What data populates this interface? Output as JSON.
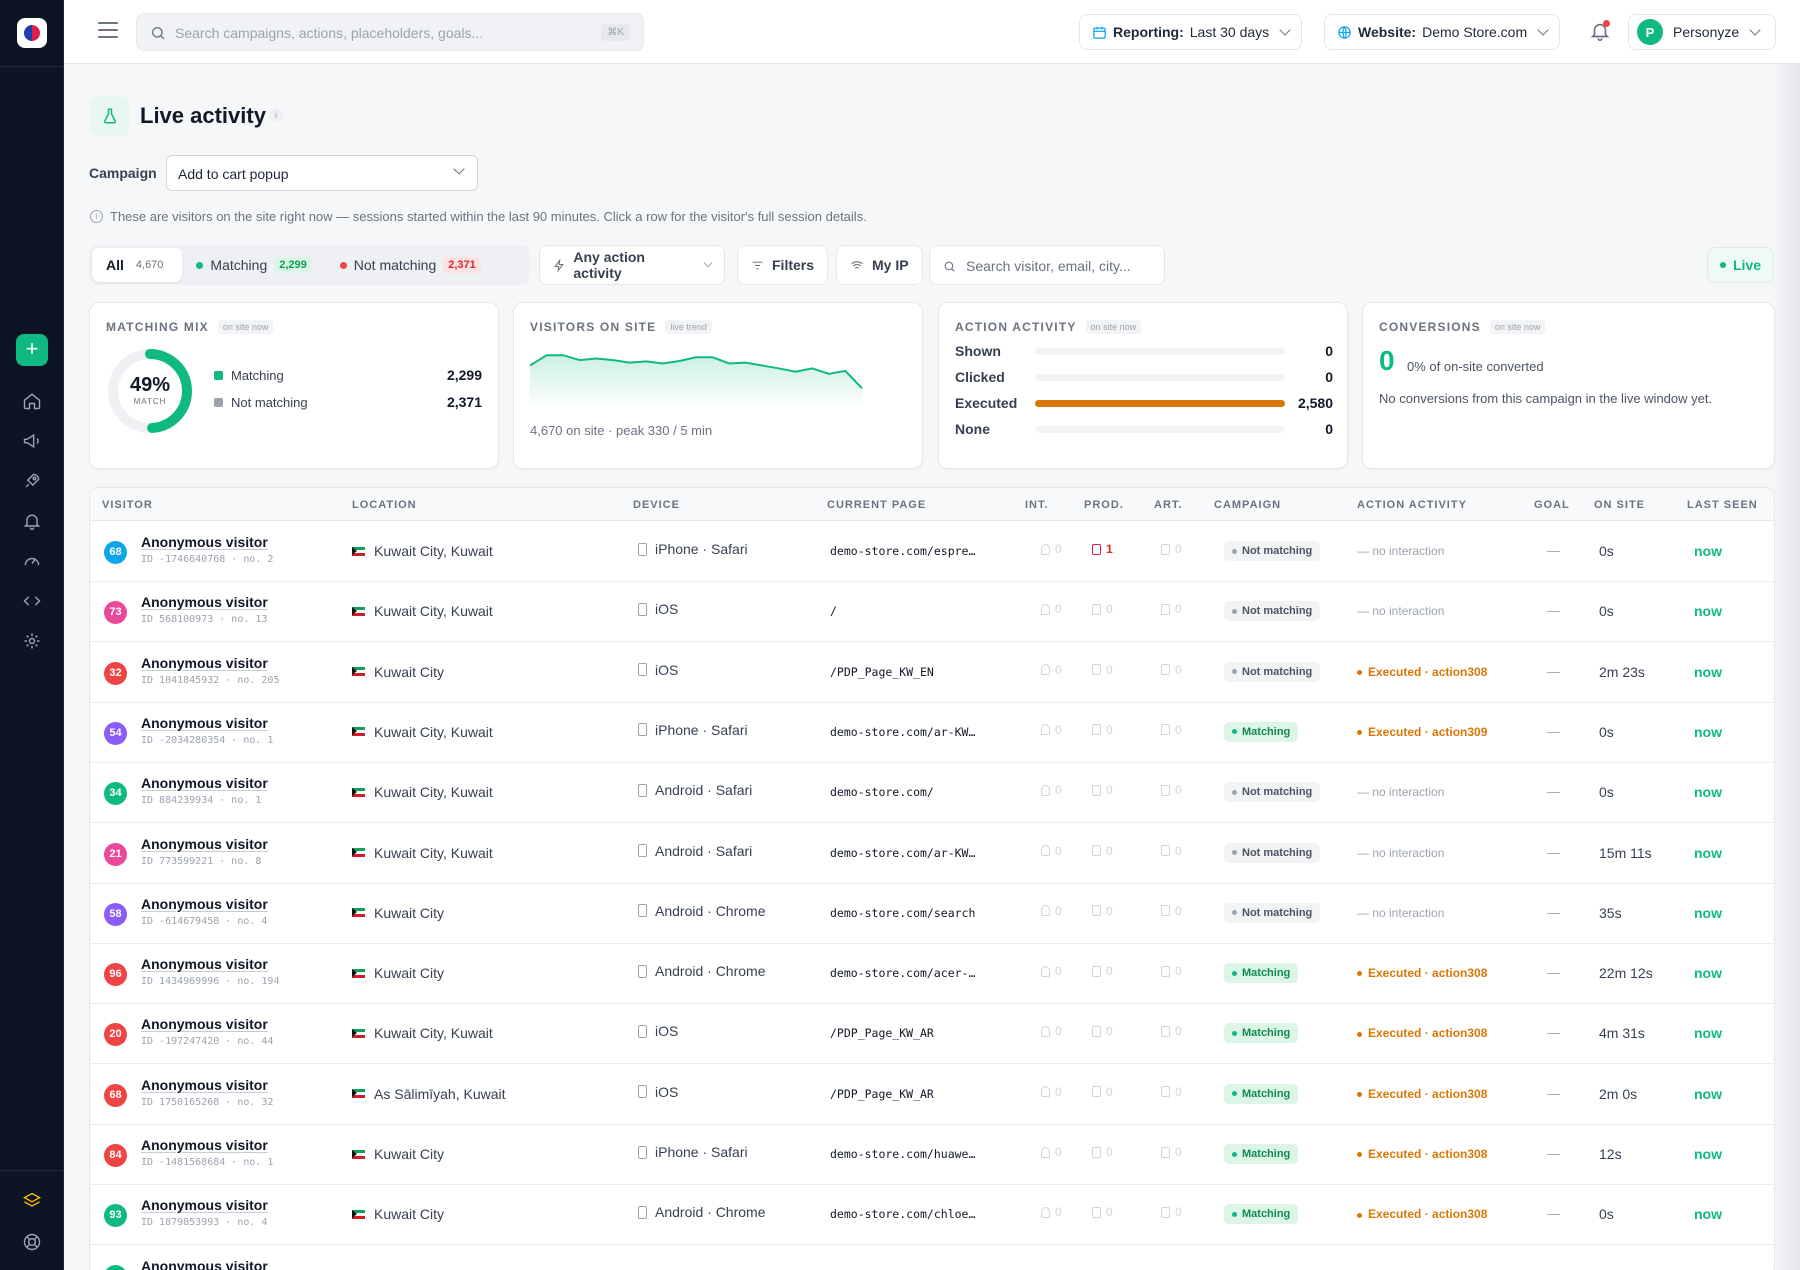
{
  "topbar": {
    "search_placeholder": "Search campaigns, actions, placeholders, goals...",
    "shortcut": "⌘K",
    "reporting_label": "Reporting:",
    "reporting_value": "Last 30 days",
    "website_label": "Website:",
    "website_value": "Demo Store.com",
    "user_initial": "P",
    "user_name": "Personyze"
  },
  "page": {
    "title": "Live activity",
    "info": "i",
    "campaign_label": "Campaign",
    "campaign_value": "Add to cart popup",
    "note": "These are visitors on the site right now — sessions started within the last 90 minutes. Click a row for the visitor's full session details."
  },
  "filters": {
    "all_label": "All",
    "all_count": "4,670",
    "matching_label": "Matching",
    "matching_count": "2,299",
    "not_matching_label": "Not matching",
    "not_matching_count": "2,371",
    "action_activity": "Any action activity",
    "filters": "Filters",
    "my_ip": "My IP",
    "search_placeholder": "Search visitor, email, city...",
    "live": "Live"
  },
  "cards": {
    "mix": {
      "title": "MATCHING MIX",
      "tag": "on site now",
      "pct": "49%",
      "pct_label": "MATCH",
      "match_fraction": 0.49,
      "rows": [
        {
          "label": "Matching",
          "value": "2,299",
          "color": "#10b981"
        },
        {
          "label": "Not matching",
          "value": "2,371",
          "color": "#9ca3af"
        }
      ]
    },
    "visitors": {
      "title": "VISITORS ON SITE",
      "tag": "live trend",
      "caption": "4,670 on site · peak 330 / 5 min"
    },
    "activity": {
      "title": "ACTION ACTIVITY",
      "tag": "on site now",
      "rows": [
        {
          "label": "Shown",
          "value": "0",
          "fraction": 0
        },
        {
          "label": "Clicked",
          "value": "0",
          "fraction": 0
        },
        {
          "label": "Executed",
          "value": "2,580",
          "fraction": 1
        },
        {
          "label": "None",
          "value": "0",
          "fraction": 0
        }
      ]
    },
    "conversions": {
      "title": "CONVERSIONS",
      "tag": "on site now",
      "big": "0",
      "pct": "0% of on-site converted",
      "desc": "No conversions from this campaign in the live window yet."
    }
  },
  "chart_data": {
    "type": "area",
    "title": "",
    "x": [
      1,
      2,
      3,
      4,
      5,
      6,
      7,
      8,
      9,
      10,
      11,
      12,
      13,
      14,
      15,
      16,
      17,
      18,
      19,
      20,
      21
    ],
    "values": [
      305,
      330,
      330,
      318,
      322,
      318,
      312,
      315,
      310,
      316,
      325,
      325,
      310,
      312,
      305,
      298,
      290,
      298,
      285,
      292,
      250
    ],
    "ylim": [
      200,
      345
    ]
  },
  "table": {
    "headers": [
      "VISITOR",
      "LOCATION",
      "DEVICE",
      "CURRENT PAGE",
      "INT.",
      "PROD.",
      "ART.",
      "CAMPAIGN",
      "ACTION ACTIVITY",
      "GOAL",
      "ON SITE",
      "LAST SEEN"
    ],
    "rows": [
      {
        "n": "68",
        "color": "#0ea5e9",
        "name": "Anonymous visitor",
        "id": "ID -1746640768 · no. 2",
        "loc": "Kuwait City, Kuwait",
        "dev": "iPhone · Safari",
        "page": "demo-store.com/espre…",
        "int": "0",
        "prod": "1",
        "art": "0",
        "camp": "Not matching",
        "act": "— no interaction",
        "goal": "—",
        "on": "0s",
        "seen": "now"
      },
      {
        "n": "73",
        "color": "#ec4899",
        "name": "Anonymous visitor",
        "id": "ID 568100973 · no. 13",
        "loc": "Kuwait City, Kuwait",
        "dev": "iOS",
        "page": "/",
        "int": "0",
        "prod": "0",
        "art": "0",
        "camp": "Not matching",
        "act": "— no interaction",
        "goal": "—",
        "on": "0s",
        "seen": "now"
      },
      {
        "n": "32",
        "color": "#ef4444",
        "name": "Anonymous visitor",
        "id": "ID 1041845932 · no. 205",
        "loc": "Kuwait City",
        "dev": "iOS",
        "page": "/PDP_Page_KW_EN",
        "int": "0",
        "prod": "0",
        "art": "0",
        "camp": "Not matching",
        "act": "Executed · action308",
        "goal": "—",
        "on": "2m 23s",
        "seen": "now"
      },
      {
        "n": "54",
        "color": "#8b5cf6",
        "name": "Anonymous visitor",
        "id": "ID -2034280354 · no. 1",
        "loc": "Kuwait City, Kuwait",
        "dev": "iPhone · Safari",
        "page": "demo-store.com/ar-KW…",
        "int": "0",
        "prod": "0",
        "art": "0",
        "camp": "Matching",
        "act": "Executed · action309",
        "goal": "—",
        "on": "0s",
        "seen": "now"
      },
      {
        "n": "34",
        "color": "#10b981",
        "name": "Anonymous visitor",
        "id": "ID 884239934 · no. 1",
        "loc": "Kuwait City, Kuwait",
        "dev": "Android · Safari",
        "page": "demo-store.com/",
        "int": "0",
        "prod": "0",
        "art": "0",
        "camp": "Not matching",
        "act": "— no interaction",
        "goal": "—",
        "on": "0s",
        "seen": "now"
      },
      {
        "n": "21",
        "color": "#ec4899",
        "name": "Anonymous visitor",
        "id": "ID 773599221 · no. 8",
        "loc": "Kuwait City, Kuwait",
        "dev": "Android · Safari",
        "page": "demo-store.com/ar-KW…",
        "int": "0",
        "prod": "0",
        "art": "0",
        "camp": "Not matching",
        "act": "— no interaction",
        "goal": "—",
        "on": "15m 11s",
        "seen": "now"
      },
      {
        "n": "58",
        "color": "#8b5cf6",
        "name": "Anonymous visitor",
        "id": "ID -614679458 · no. 4",
        "loc": "Kuwait City",
        "dev": "Android · Chrome",
        "page": "demo-store.com/search",
        "int": "0",
        "prod": "0",
        "art": "0",
        "camp": "Not matching",
        "act": "— no interaction",
        "goal": "—",
        "on": "35s",
        "seen": "now"
      },
      {
        "n": "96",
        "color": "#ef4444",
        "name": "Anonymous visitor",
        "id": "ID 1434969996 · no. 194",
        "loc": "Kuwait City",
        "dev": "Android · Chrome",
        "page": "demo-store.com/acer-…",
        "int": "0",
        "prod": "0",
        "art": "0",
        "camp": "Matching",
        "act": "Executed · action308",
        "goal": "—",
        "on": "22m 12s",
        "seen": "now"
      },
      {
        "n": "20",
        "color": "#ef4444",
        "name": "Anonymous visitor",
        "id": "ID -197247420 · no. 44",
        "loc": "Kuwait City, Kuwait",
        "dev": "iOS",
        "page": "/PDP_Page_KW_AR",
        "int": "0",
        "prod": "0",
        "art": "0",
        "camp": "Matching",
        "act": "Executed · action308",
        "goal": "—",
        "on": "4m 31s",
        "seen": "now"
      },
      {
        "n": "68",
        "color": "#ef4444",
        "name": "Anonymous visitor",
        "id": "ID 1750165268 · no. 32",
        "loc": "As Sālimīyah, Kuwait",
        "dev": "iOS",
        "page": "/PDP_Page_KW_AR",
        "int": "0",
        "prod": "0",
        "art": "0",
        "camp": "Matching",
        "act": "Executed · action308",
        "goal": "—",
        "on": "2m 0s",
        "seen": "now"
      },
      {
        "n": "84",
        "color": "#ef4444",
        "name": "Anonymous visitor",
        "id": "ID -1481568684 · no. 1",
        "loc": "Kuwait City",
        "dev": "iPhone · Safari",
        "page": "demo-store.com/huawe…",
        "int": "0",
        "prod": "0",
        "art": "0",
        "camp": "Matching",
        "act": "Executed · action308",
        "goal": "—",
        "on": "12s",
        "seen": "now"
      },
      {
        "n": "93",
        "color": "#10b981",
        "name": "Anonymous visitor",
        "id": "ID 1879853993 · no. 4",
        "loc": "Kuwait City",
        "dev": "Android · Chrome",
        "page": "demo-store.com/chloe…",
        "int": "0",
        "prod": "0",
        "art": "0",
        "camp": "Matching",
        "act": "Executed · action308",
        "goal": "—",
        "on": "0s",
        "seen": "now"
      },
      {
        "n": "",
        "color": "#10b981",
        "name": "Anonymous visitor",
        "id": "",
        "loc": "",
        "dev": "",
        "page": "",
        "int": "",
        "prod": "",
        "art": "",
        "camp": "",
        "act": "",
        "goal": "",
        "on": "",
        "seen": ""
      }
    ]
  }
}
